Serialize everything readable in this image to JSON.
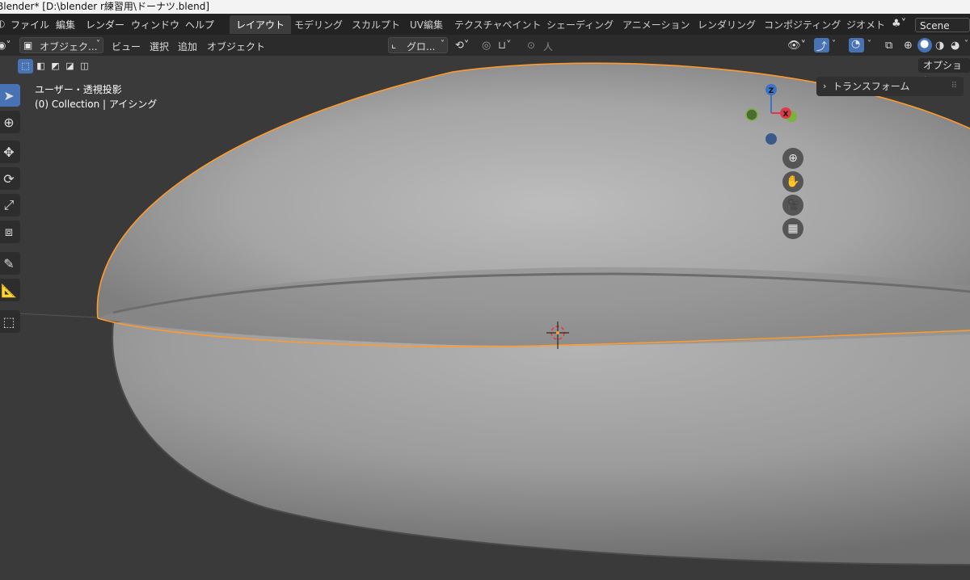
{
  "window": {
    "title": "Blender* [D:\\blender r練習用\\ドーナツ.blend]"
  },
  "menu": [
    "ファイル",
    "編集",
    "レンダー",
    "ウィンドウ",
    "ヘルプ"
  ],
  "workspaces": [
    "レイアウト",
    "モデリング",
    "スカルプト",
    "UV編集",
    "テクスチャペイント",
    "シェーディング",
    "アニメーション",
    "レンダリング",
    "コンポジティング",
    "ジオメト"
  ],
  "scene": "Scene",
  "header": {
    "mode": "オブジェク...",
    "menus": [
      "ビュー",
      "選択",
      "追加",
      "オブジェクト"
    ],
    "transform_orientation": "グロ...",
    "pivot_label": "人"
  },
  "options_label": "オプション",
  "viewport": {
    "view_name": "ユーザー・透視投影",
    "collection_info": "(0) Collection | アイシング"
  },
  "gizmo": {
    "z": "Z",
    "x": "X"
  },
  "sidebar": {
    "panel": "トランスフォーム"
  },
  "colors": {
    "active_blue": "#4772b3",
    "outline_orange": "#ff9a2e",
    "axis_x": "#e0384b",
    "axis_y": "#79b33a",
    "axis_z": "#3b73c7"
  }
}
